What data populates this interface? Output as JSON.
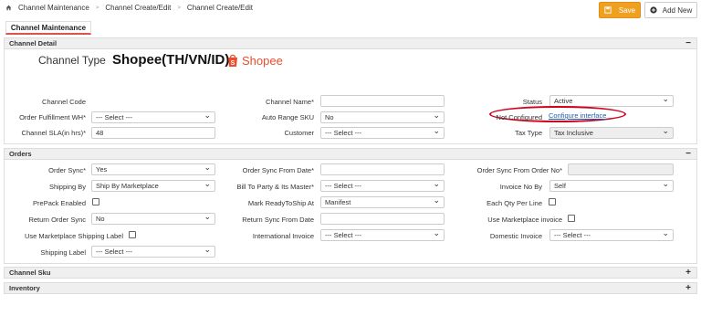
{
  "breadcrumb": {
    "items": [
      "Channel Maintenance",
      "Channel Create/Edit",
      "Channel Create/Edit"
    ]
  },
  "toolbar": {
    "save_label": "Save",
    "add_new_label": "Add New"
  },
  "tab": {
    "label": "Channel Maintenance"
  },
  "channel_detail": {
    "title": "Channel Detail",
    "collapse_icon": "−",
    "channel_type_label": "Channel Type",
    "channel_type_value": "Shopee(TH/VN/ID)",
    "logo_text": "Shopee",
    "fields": {
      "channel_code": {
        "label": "Channel Code"
      },
      "order_fulfillment_wh": {
        "label": "Order Fulfillment WH*",
        "value": "--- Select ---"
      },
      "channel_sla": {
        "label": "Channel SLA(in hrs)*",
        "value": "48"
      },
      "channel_name": {
        "label": "Channel Name*",
        "value": ""
      },
      "auto_range_sku": {
        "label": "Auto Range SKU",
        "value": "No"
      },
      "customer": {
        "label": "Customer",
        "value": "--- Select ---"
      },
      "status": {
        "label": "Status",
        "value": "Active"
      },
      "not_configured": {
        "label": "Not Configured",
        "link": "Configure interface"
      },
      "tax_type": {
        "label": "Tax Type",
        "value": "Tax Inclusive"
      }
    }
  },
  "orders": {
    "title": "Orders",
    "collapse_icon": "−",
    "fields": {
      "order_sync": {
        "label": "Order Sync*",
        "value": "Yes"
      },
      "shipping_by": {
        "label": "Shipping By",
        "value": "Ship By Marketplace"
      },
      "prepack_enabled": {
        "label": "PrePack Enabled"
      },
      "return_order_sync": {
        "label": "Return Order Sync",
        "value": "No"
      },
      "use_marketplace_shipping_label": {
        "label": "Use Marketplace Shipping Label"
      },
      "shipping_label": {
        "label": "Shipping Label",
        "value": "--- Select ---"
      },
      "order_sync_from_date": {
        "label": "Order Sync From Date*",
        "value": ""
      },
      "bill_to_party": {
        "label": "Bill To Party & Its Master*",
        "value": "--- Select ---"
      },
      "mark_ready_to_ship_at": {
        "label": "Mark ReadyToShip At",
        "value": "Manifest"
      },
      "return_sync_from_date": {
        "label": "Return Sync From Date",
        "value": ""
      },
      "international_invoice": {
        "label": "International Invoice",
        "value": "--- Select ---"
      },
      "order_sync_from_order_no": {
        "label": "Order Sync From Order No*",
        "value": ""
      },
      "invoice_no_by": {
        "label": "Invoice No By",
        "value": "Self"
      },
      "each_qty_per_line": {
        "label": "Each Qty Per Line"
      },
      "use_marketplace_invoice": {
        "label": "Use Marketplace invoice"
      },
      "domestic_invoice": {
        "label": "Domestic Invoice",
        "value": "--- Select ---"
      }
    }
  },
  "channel_sku": {
    "title": "Channel Sku",
    "expand_icon": "+"
  },
  "inventory": {
    "title": "Inventory",
    "expand_icon": "+"
  },
  "colors": {
    "accent": "#f0a020",
    "tab_underline": "#d9534f",
    "highlight": "#d0021b",
    "brand": "#ee4d2d",
    "link": "#1a5fb4"
  }
}
